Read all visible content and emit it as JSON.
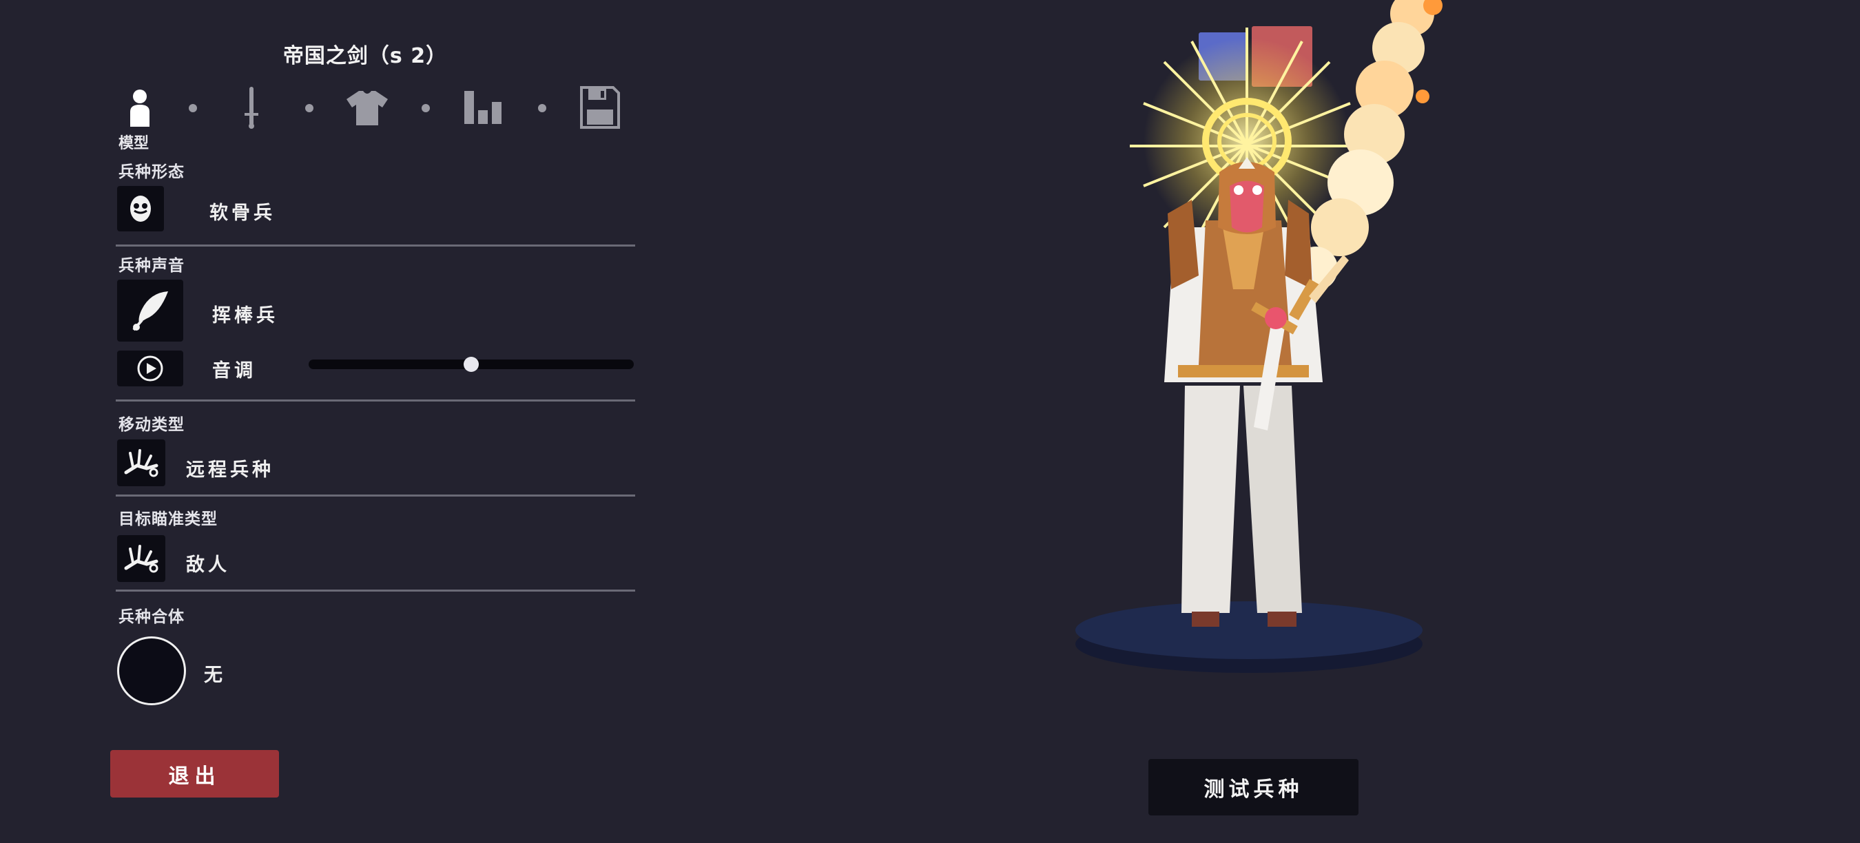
{
  "header": {
    "unit_title": "帝国之剑（s 2）"
  },
  "tabs": [
    {
      "name": "model",
      "icon": "person-icon",
      "active": true
    },
    {
      "name": "weapon",
      "icon": "sword-icon",
      "active": false
    },
    {
      "name": "clothing",
      "icon": "shirt-icon",
      "active": false
    },
    {
      "name": "stats",
      "icon": "bar-chart-icon",
      "active": false
    },
    {
      "name": "save",
      "icon": "floppy-disk-icon",
      "active": false
    }
  ],
  "active_tab_label": "模型",
  "sections": {
    "unit_base": {
      "label": "兵种形态",
      "value": "软骨兵",
      "icon": "mask-face-icon"
    },
    "unit_voice": {
      "label": "兵种声音",
      "value": "挥棒兵",
      "icon": "feather-icon"
    },
    "pitch": {
      "label": "音调",
      "icon": "play-icon",
      "level": 0.5
    },
    "movement": {
      "label": "移动类型",
      "value": "远程兵种",
      "icon": "fallen-unit-icon"
    },
    "targeting": {
      "label": "目标瞄准类型",
      "value": "敌人",
      "icon": "fallen-unit-icon"
    },
    "combine": {
      "label": "兵种合体",
      "value": "无"
    }
  },
  "buttons": {
    "exit": "退出",
    "test_unit": "测试兵种"
  },
  "team_colors": {
    "blue": "#5b6bc8",
    "red": "#c25a5c"
  },
  "colors": {
    "background": "#23222f",
    "exit_button": "#9b3338"
  }
}
